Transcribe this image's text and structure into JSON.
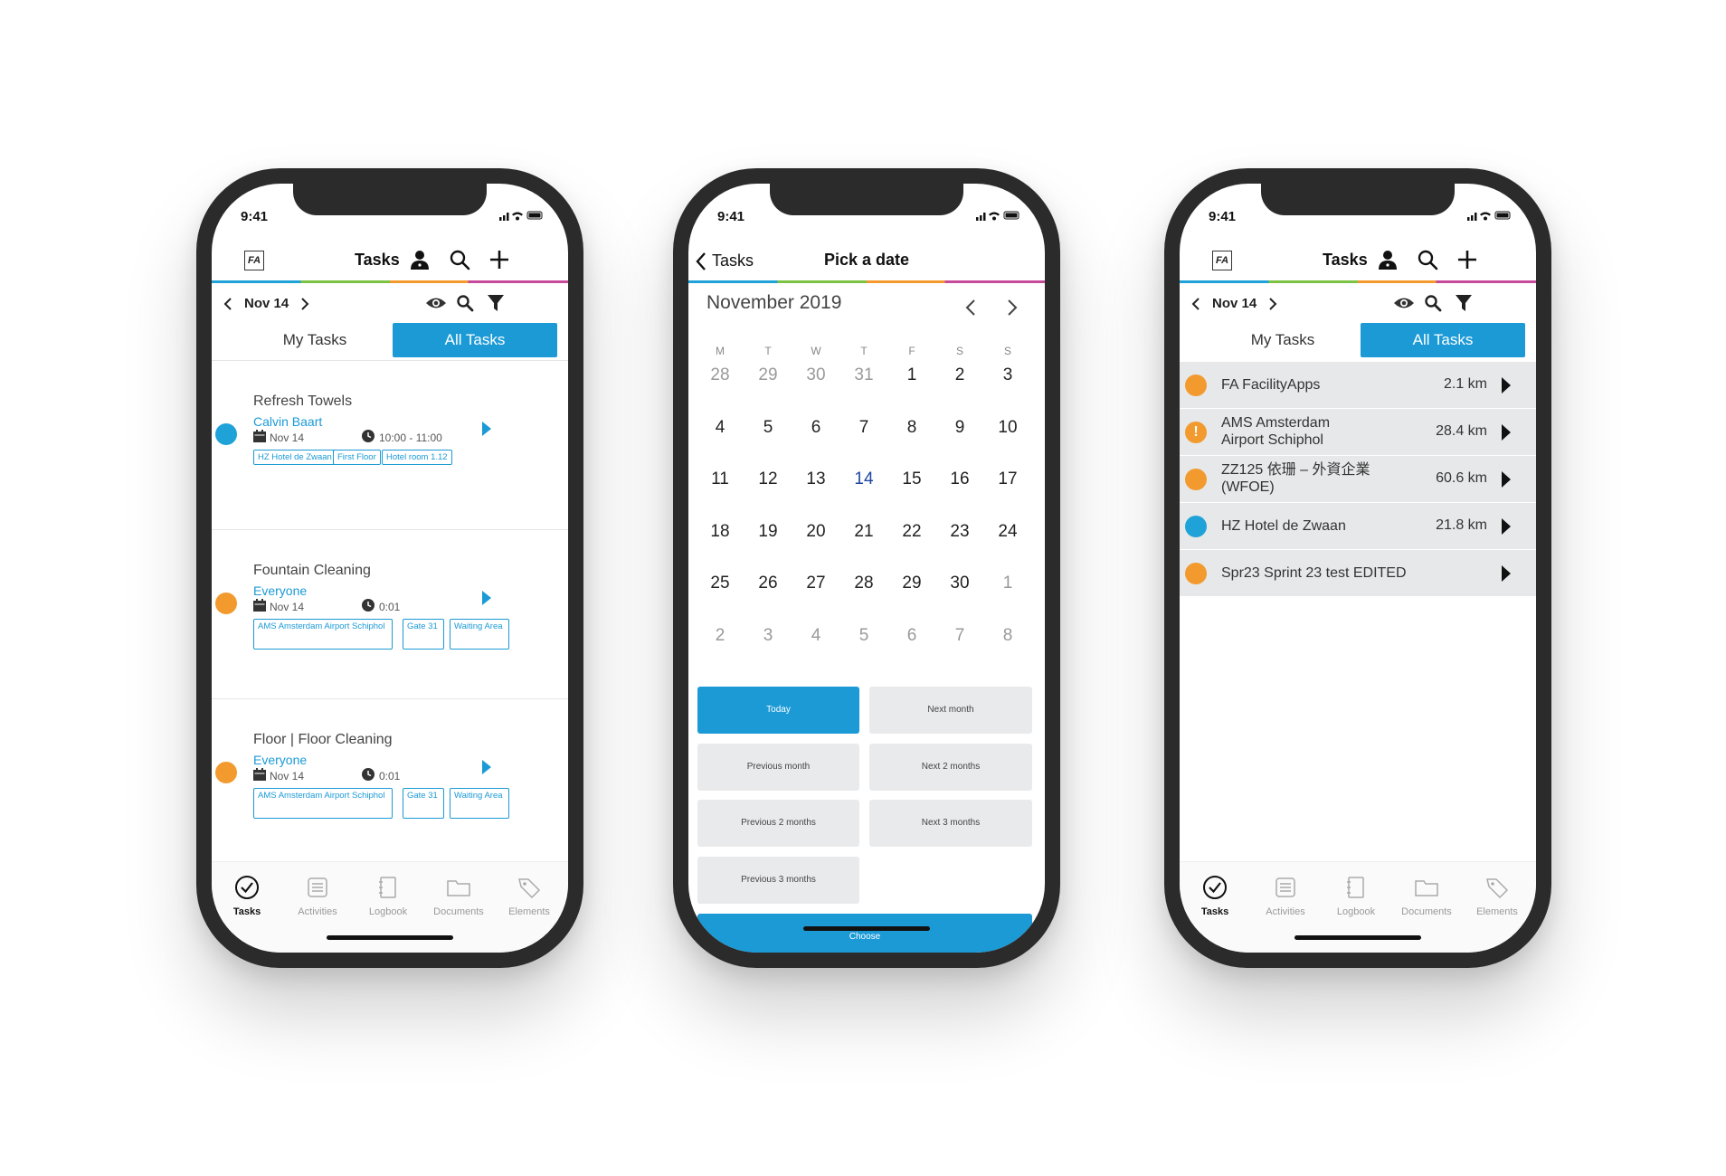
{
  "status_time": "9:41",
  "colors": {
    "accent": "#1b9ad6",
    "orange": "#f29a2e",
    "blue_dot": "#1fa2d8",
    "row_bg": "#e7e8e9"
  },
  "phone1": {
    "header": {
      "logo": "FA",
      "title": "Tasks"
    },
    "date_label": "Nov 14",
    "tabs": {
      "mine": "My Tasks",
      "all": "All Tasks"
    },
    "tasks": [
      {
        "title": "Refresh Towels",
        "assignee": "Calvin Baart",
        "date": "Nov 14",
        "time": "10:00 - 11:00",
        "status_color": "#1fa2d8",
        "tags": [
          "HZ Hotel de Zwaan",
          "First Floor",
          "Hotel room 1.12"
        ]
      },
      {
        "title": "Fountain Cleaning",
        "assignee": "Everyone",
        "date": "Nov 14",
        "time": "0:01",
        "status_color": "#f29a2e",
        "tags": [
          "AMS Amsterdam Airport Schiphol",
          "Gate 31",
          "Waiting Area"
        ]
      },
      {
        "title": "Floor | Floor Cleaning",
        "assignee": "Everyone",
        "date": "Nov 14",
        "time": "0:01",
        "status_color": "#f29a2e",
        "tags": [
          "AMS Amsterdam Airport Schiphol",
          "Gate 31",
          "Waiting Area"
        ]
      }
    ]
  },
  "phone2": {
    "back_label": "Tasks",
    "title": "Pick a date",
    "month": "November 2019",
    "weekdays": [
      "M",
      "T",
      "W",
      "T",
      "F",
      "S",
      "S"
    ],
    "weeks": [
      [
        "28",
        "29",
        "30",
        "31",
        "1",
        "2",
        "3"
      ],
      [
        "4",
        "5",
        "6",
        "7",
        "8",
        "9",
        "10"
      ],
      [
        "11",
        "12",
        "13",
        "14",
        "15",
        "16",
        "17"
      ],
      [
        "18",
        "19",
        "20",
        "21",
        "22",
        "23",
        "24"
      ],
      [
        "25",
        "26",
        "27",
        "28",
        "29",
        "30",
        "1"
      ],
      [
        "2",
        "3",
        "4",
        "5",
        "6",
        "7",
        "8"
      ]
    ],
    "selected_day": "14",
    "buttons": {
      "today": "Today",
      "next_month": "Next month",
      "previous_month": "Previous month",
      "next_2_months": "Next 2 months",
      "previous_2_months": "Previous 2 months",
      "next_3_months": "Next 3 months",
      "previous_3_months": "Previous 3 months",
      "choose": "Choose"
    }
  },
  "phone3": {
    "header": {
      "logo": "FA",
      "title": "Tasks"
    },
    "date_label": "Nov 14",
    "tabs": {
      "mine": "My Tasks",
      "all": "All Tasks"
    },
    "locations": [
      {
        "name": "FA FacilityApps",
        "distance": "2.1 km",
        "status_color": "#f29a2e",
        "warning": false
      },
      {
        "name": "AMS Amsterdam\nAirport Schiphol",
        "distance": "28.4 km",
        "status_color": "#f29a2e",
        "warning": true
      },
      {
        "name": "ZZ125 依珊 – 外資企業\n(WFOE)",
        "distance": "60.6 km",
        "status_color": "#f29a2e",
        "warning": false
      },
      {
        "name": "HZ Hotel de Zwaan",
        "distance": "21.8 km",
        "status_color": "#1fa2d8",
        "warning": false
      },
      {
        "name": "Spr23 Sprint 23 test EDITED",
        "distance": "",
        "status_color": "#f29a2e",
        "warning": false
      }
    ]
  },
  "tabbar": [
    "Tasks",
    "Activities",
    "Logbook",
    "Documents",
    "Elements"
  ]
}
